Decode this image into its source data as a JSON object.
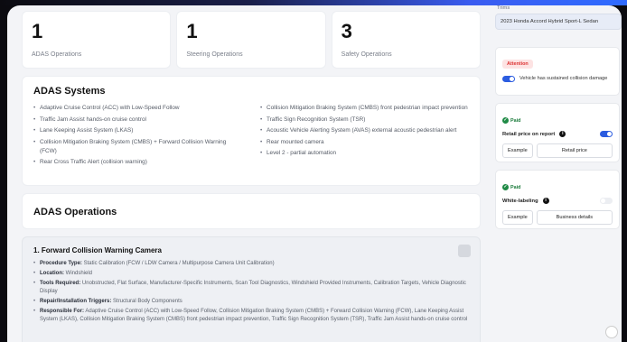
{
  "stats": [
    {
      "value": "1",
      "label": "ADAS Operations"
    },
    {
      "value": "1",
      "label": "Steering Operations"
    },
    {
      "value": "3",
      "label": "Safety Operations"
    }
  ],
  "systems": {
    "title": "ADAS Systems",
    "left": [
      "Adaptive Cruise Control (ACC) with Low-Speed Follow",
      "Traffic Jam Assist hands-on cruise control",
      "Lane Keeping Assist System (LKAS)",
      "Collision Mitigation Braking System (CMBS) + Forward Collision Warning (FCW)",
      "Rear Cross Traffic Alert (collision warning)"
    ],
    "right": [
      "Collision Mitigation Braking System (CMBS) front pedestrian impact prevention",
      "Traffic Sign Recognition System (TSR)",
      "Acoustic Vehicle Alerting System (AVAS) external acoustic pedestrian alert",
      "Rear mounted camera",
      "Level 2 - partial automation"
    ]
  },
  "operations": {
    "title": "ADAS Operations",
    "card": {
      "title": "1. Forward Collision Warning Camera",
      "items": [
        {
          "label": "Procedure Type:",
          "value": "Static Calibration (FCW / LDW Camera / Multipurpose Camera Unit Calibration)"
        },
        {
          "label": "Location:",
          "value": "Windshield"
        },
        {
          "label": "Tools Required:",
          "value": "Unobstructed, Flat Surface, Manufacturer-Specific Instruments, Scan Tool Diagnostics, Windshield Provided Instruments, Calibration Targets, Vehicle Diagnostic Display"
        },
        {
          "label": "Repair/Installation Triggers:",
          "value": "Structural Body Components"
        },
        {
          "label": "Responsible For:",
          "value": "Adaptive Cruise Control (ACC) with Low-Speed Follow, Collision Mitigation Braking System (CMBS) + Forward Collision Warning (FCW), Lane Keeping Assist System (LKAS), Collision Mitigation Braking System (CMBS) front pedestrian impact prevention, Traffic Sign Recognition System (TSR), Traffic Jam Assist hands-on cruise control"
        }
      ]
    }
  },
  "sidebar": {
    "trims_label": "Trims",
    "trims_value": "2023 Honda Accord Hybrid Sport-L Sedan",
    "attention": {
      "badge": "Attention",
      "toggle_text": "Vehicle has sustained collision damage"
    },
    "paid_retail": {
      "badge": "Paid",
      "label": "Retail price on report",
      "btn_example": "Example",
      "btn_action": "Retail price"
    },
    "paid_white": {
      "badge": "Paid",
      "label": "White-labeling",
      "btn_example": "Example",
      "btn_action": "Business details"
    }
  }
}
